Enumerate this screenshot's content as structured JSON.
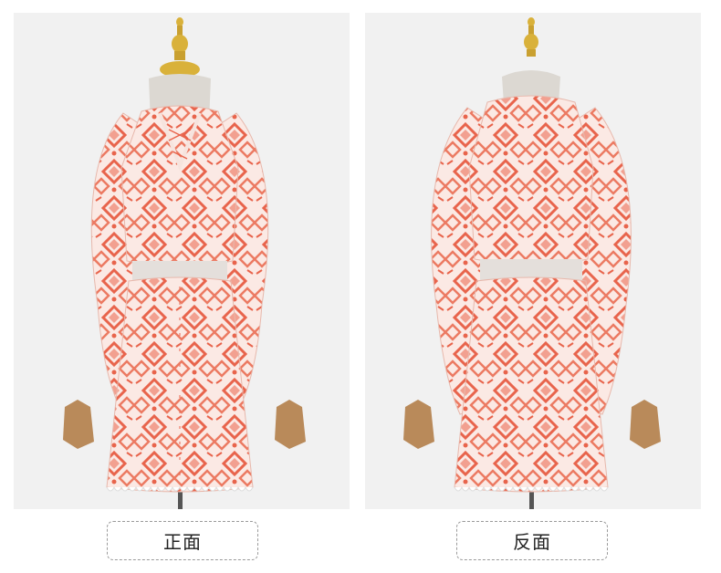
{
  "photos": [
    {
      "view": "front",
      "caption": "正面",
      "image": "pink-ikat-print-blouse-and-skirt-set-on-mannequin-front-view"
    },
    {
      "view": "back",
      "caption": "反面",
      "image": "pink-ikat-print-blouse-and-skirt-set-on-mannequin-back-view"
    }
  ],
  "colors": {
    "background": "#f1f1f1",
    "fabric_base": "#fbe9e4",
    "print_coral": "#e8644c",
    "print_pink": "#f2a090",
    "mannequin_gold": "#d9b13a",
    "mannequin_hands": "#b98a5a",
    "mannequin_neck": "#dcd8d2"
  }
}
